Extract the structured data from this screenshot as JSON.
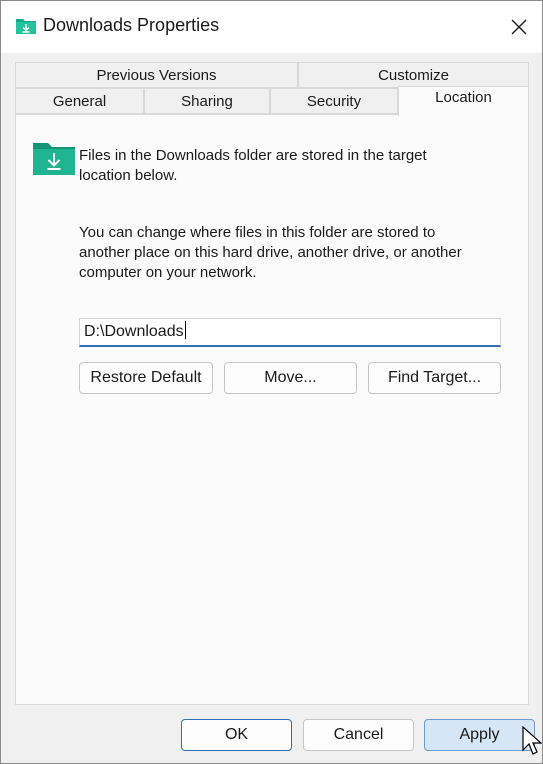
{
  "window": {
    "title": "Downloads Properties",
    "close_icon": "close-icon"
  },
  "tabs": {
    "row_back": [
      {
        "label": "Previous Versions"
      },
      {
        "label": "Customize"
      }
    ],
    "row_front": [
      {
        "label": "General"
      },
      {
        "label": "Sharing"
      },
      {
        "label": "Security"
      },
      {
        "label": "Location",
        "active": true
      }
    ]
  },
  "location": {
    "info_text_1": "Files in the Downloads folder are stored in the target",
    "info_text_2": "location below.",
    "desc_line_1": "You can change where files in this folder are stored to",
    "desc_line_2": "another place on this hard drive, another drive, or another",
    "desc_line_3": "computer on your network.",
    "path_value": "D:\\Downloads",
    "restore_label": "Restore Default",
    "move_label": "Move...",
    "find_label": "Find Target..."
  },
  "footer": {
    "ok_label": "OK",
    "cancel_label": "Cancel",
    "apply_label": "Apply"
  },
  "colors": {
    "accent": "#2e6fb7",
    "folder": "#1ba888",
    "apply_bg": "#d6e6f5"
  }
}
